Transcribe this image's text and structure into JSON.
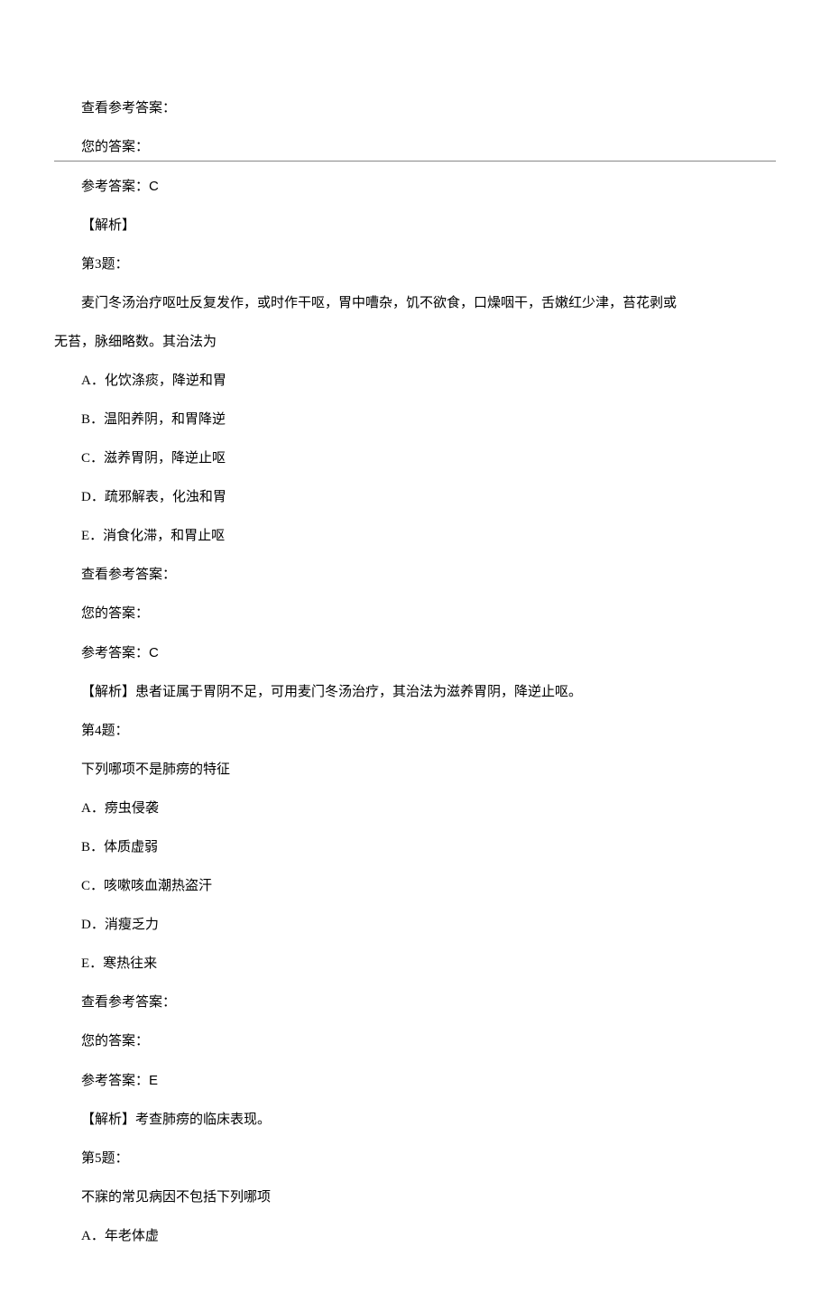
{
  "block1": {
    "view_answer": "查看参考答案：",
    "your_answer": "您的答案：",
    "ref_answer_label": "参考答案：",
    "ref_answer_value": "C",
    "analysis": "【解析】"
  },
  "q3": {
    "title": "第3题：",
    "stem_line1": "麦门冬汤治疗呕吐反复发作，或时作干呕，胃中嘈杂，饥不欲食，口燥咽干，舌嫩红少津，苔花剥或",
    "stem_line2": "无苔，脉细略数。其治法为",
    "opt_a": "A．化饮涤痰，降逆和胃",
    "opt_b": "B．温阳养阴，和胃降逆",
    "opt_c": "C．滋养胃阴，降逆止呕",
    "opt_d": "D．疏邪解表，化浊和胃",
    "opt_e": "E．消食化滞，和胃止呕",
    "view_answer": "查看参考答案：",
    "your_answer": "您的答案：",
    "ref_answer_label": "参考答案：",
    "ref_answer_value": "C",
    "analysis": "【解析】患者证属于胃阴不足，可用麦门冬汤治疗，其治法为滋养胃阴，降逆止呕。"
  },
  "q4": {
    "title": "第4题：",
    "stem": "下列哪项不是肺痨的特征",
    "opt_a": "A．痨虫侵袭",
    "opt_b": "B．体质虚弱",
    "opt_c": "C．咳嗽咳血潮热盗汗",
    "opt_d": "D．消瘦乏力",
    "opt_e": "E．寒热往来",
    "view_answer": "查看参考答案：",
    "your_answer": "您的答案：",
    "ref_answer_label": "参考答案：",
    "ref_answer_value": "E",
    "analysis": "【解析】考查肺痨的临床表现。"
  },
  "q5": {
    "title": "第5题：",
    "stem": "不寐的常见病因不包括下列哪项",
    "opt_a": "A．年老体虚"
  }
}
